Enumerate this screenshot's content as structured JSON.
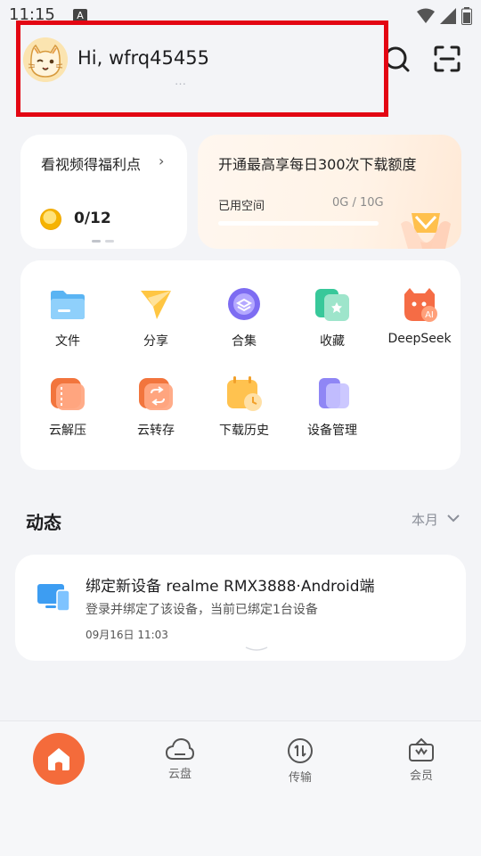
{
  "status_bar": {
    "time": "11:15",
    "indicator": "A"
  },
  "header": {
    "greeting": "Hi, wfrq45455",
    "sub_hint": "…",
    "search_icon": "search-icon",
    "scan_icon": "scan-icon"
  },
  "welfare_card": {
    "title": "看视频得福利点",
    "chevron": "›",
    "count": "0/12"
  },
  "vip_card": {
    "title": "开通最高享每日300次下载额度",
    "space_label": "已用空间",
    "space_value": "0G / 10G",
    "space_used_fraction": 0
  },
  "tools": [
    {
      "label": "文件",
      "icon": "folder-icon"
    },
    {
      "label": "分享",
      "icon": "share-icon"
    },
    {
      "label": "合集",
      "icon": "collection-icon"
    },
    {
      "label": "收藏",
      "icon": "favorite-icon"
    },
    {
      "label": "DeepSeek",
      "icon": "deepseek-ai-icon"
    },
    {
      "label": "云解压",
      "icon": "unzip-icon"
    },
    {
      "label": "云转存",
      "icon": "transfer-icon"
    },
    {
      "label": "下载历史",
      "icon": "download-history-icon"
    },
    {
      "label": "设备管理",
      "icon": "device-manage-icon"
    }
  ],
  "activity_section": {
    "title": "动态",
    "filter": "本月"
  },
  "activity_item": {
    "title": "绑定新设备  realme  RMX3888·Android端",
    "description": "登录并绑定了该设备，当前已绑定1台设备",
    "time": "09月16日 11:03"
  },
  "bottom_nav": [
    {
      "label": "",
      "icon": "home-icon"
    },
    {
      "label": "云盘",
      "icon": "cloud-icon"
    },
    {
      "label": "传输",
      "icon": "transfer-arrows-icon"
    },
    {
      "label": "会员",
      "icon": "member-crown-icon"
    }
  ],
  "colors": {
    "accent": "#f46b3b",
    "highlight_box": "#e30613",
    "background": "#f3f4f7"
  }
}
